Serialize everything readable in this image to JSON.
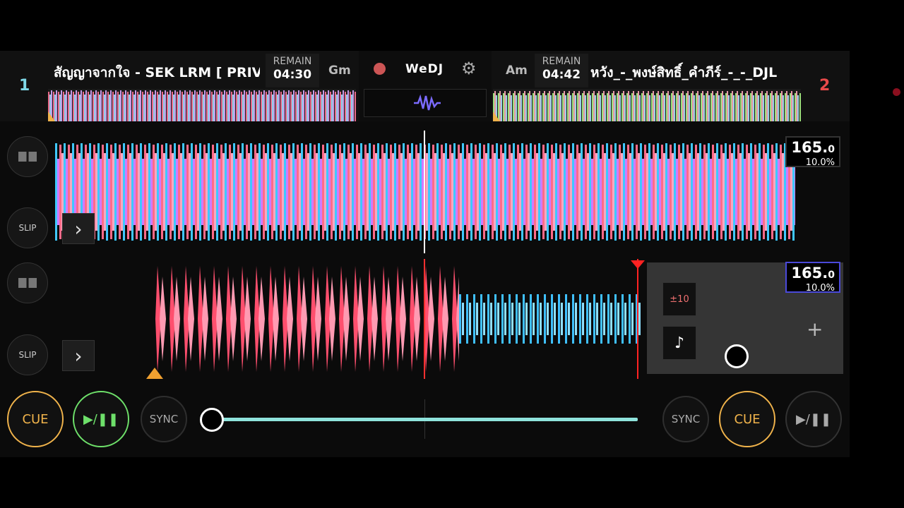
{
  "deck1": {
    "number": "1",
    "title": "สัญญาจากใจ - SEK LRM [ PRIV",
    "remain_label": "REMAIN",
    "remain_time": "04:30",
    "key": "Gm",
    "bpm_main": "165.",
    "bpm_decimal": "0",
    "pitch": "10.0%",
    "slip_label": "SLIP"
  },
  "deck2": {
    "number": "2",
    "title": "หวัง_-_พงษ์สิทธิ์_คำภีร์_-_-_DJL",
    "remain_label": "REMAIN",
    "remain_time": "04:42",
    "key": "Am",
    "bpm_main": "165.",
    "bpm_decimal": "0",
    "pitch": "10.0%",
    "slip_label": "SLIP",
    "pitch_range_label": "±10"
  },
  "center": {
    "logo": "WeDJ",
    "record_icon": "record-icon",
    "settings_icon": "gear-icon",
    "waveform_icon": "waveform-icon"
  },
  "transport": {
    "cue1": "CUE",
    "play1": "▶/❚❚",
    "sync1": "SYNC",
    "sync2": "SYNC",
    "cue2": "CUE",
    "play2": "▶/❚❚"
  },
  "crossfader": {
    "position": 0.0
  },
  "colors": {
    "cue": "#f0b34b",
    "play_active": "#6ee06a",
    "crossfader": "#8fe3dc",
    "deck1": "#7fd8e8",
    "deck2": "#e84a4a"
  }
}
